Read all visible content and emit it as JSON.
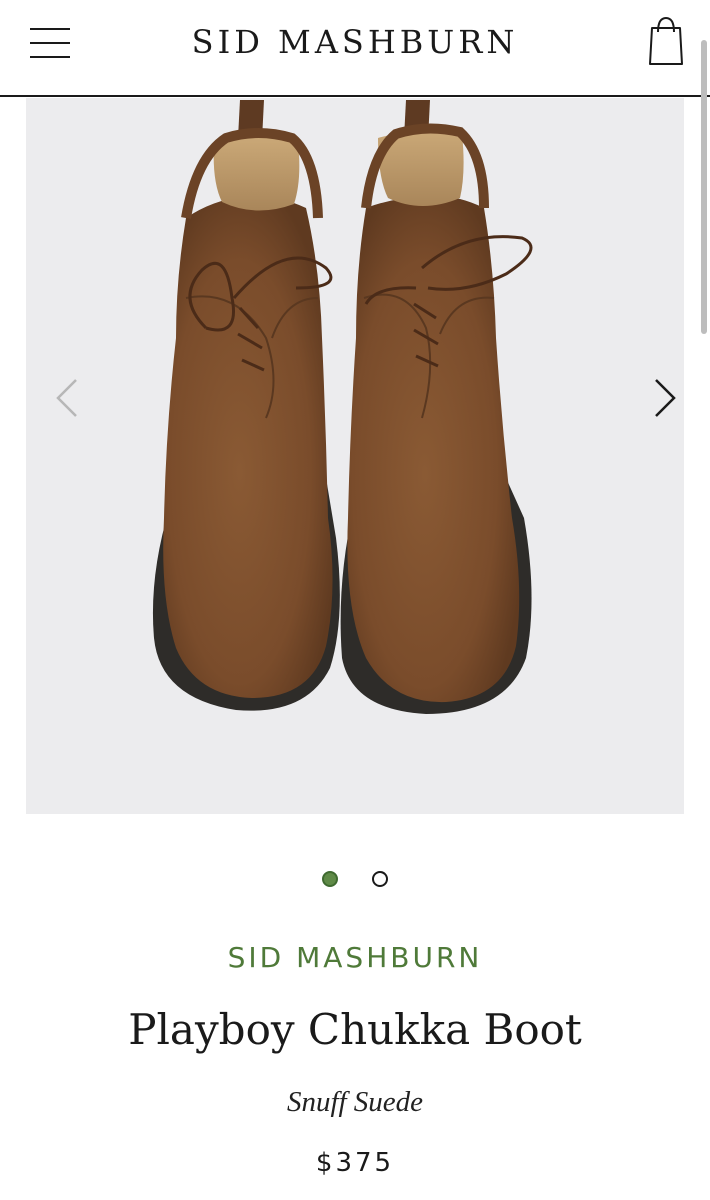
{
  "header": {
    "logo": "SID MASHBURN",
    "menu_icon": "hamburger-menu-icon",
    "bag_icon": "shopping-bag-icon"
  },
  "gallery": {
    "image_alt": "Playboy Chukka Boot",
    "prev_icon": "chevron-left-icon",
    "next_icon": "chevron-right-icon",
    "slide_count": 2,
    "active_slide": 1
  },
  "product": {
    "brand": "SID MASHBURN",
    "name": "Playboy Chukka Boot",
    "color": "Snuff Suede",
    "price": "$375"
  },
  "colors": {
    "accent_green": "#4f7a39",
    "active_dot": "#5f8a47",
    "gallery_bg": "#ececee"
  }
}
